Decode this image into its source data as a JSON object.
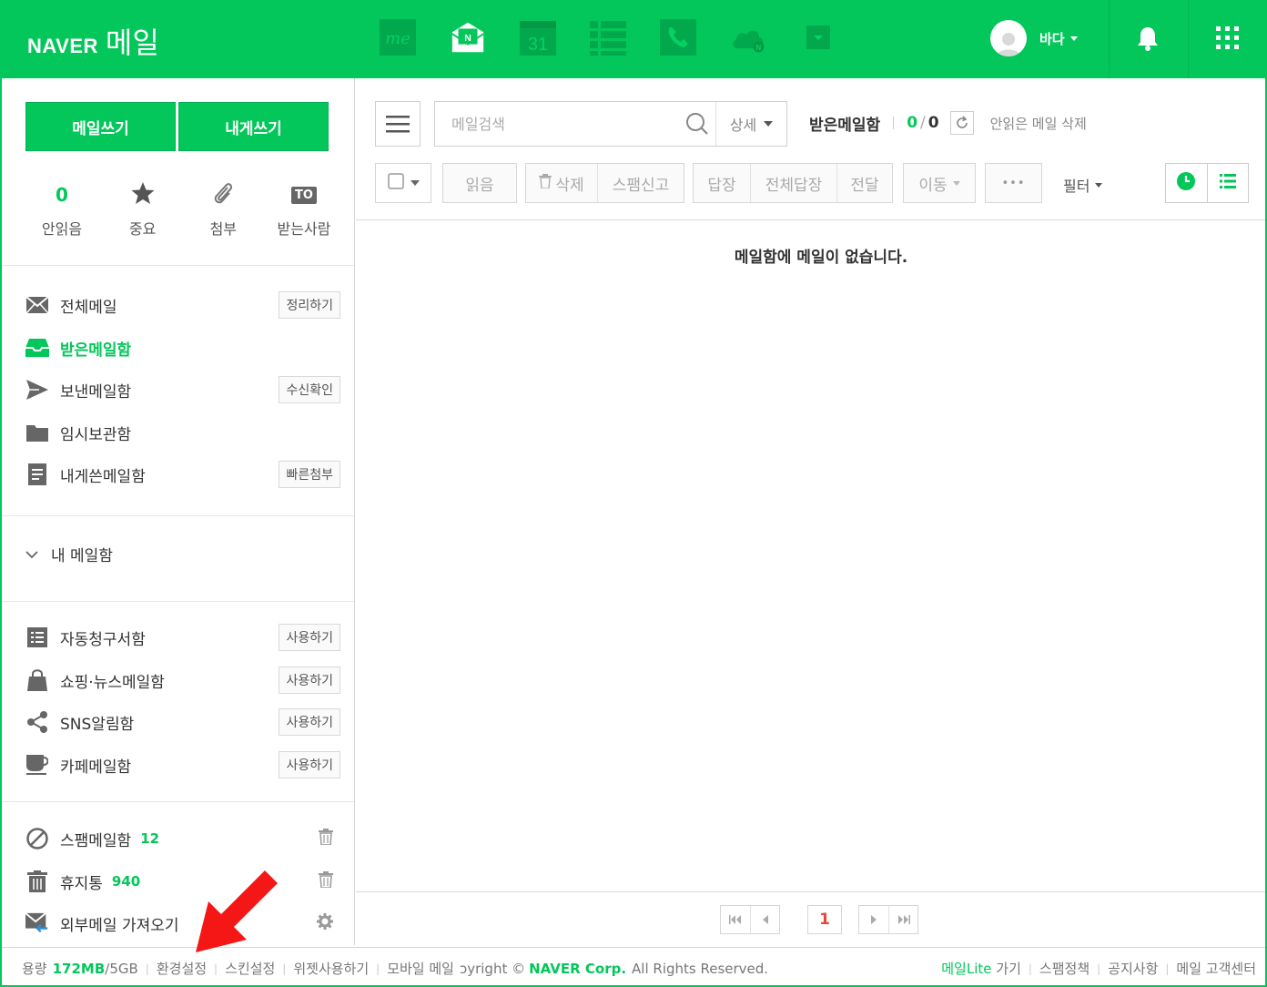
{
  "header": {
    "logo_naver": "NAVER",
    "logo_mail": "메일",
    "apps": [
      "me-icon",
      "mail-icon",
      "calendar-icon",
      "contacts-icon",
      "phone-icon",
      "cloud-icon",
      "more-dropdown-icon"
    ],
    "calendar_day": "31",
    "profile_name": "바다",
    "brand_color": "#03c75a"
  },
  "sidebar": {
    "write_mail": "메일쓰기",
    "write_to_me": "내게쓰기",
    "quick": {
      "unread_count": "0",
      "unread_label": "안읽음",
      "important_label": "중요",
      "attach_label": "첨부",
      "to_badge": "TO",
      "recipient_label": "받는사람"
    },
    "folders": [
      {
        "label": "전체메일",
        "button": "정리하기",
        "icon": "envelope-icon"
      },
      {
        "label": "받은메일함",
        "button": "",
        "icon": "inbox-icon"
      },
      {
        "label": "보낸메일함",
        "button": "수신확인",
        "icon": "send-icon"
      },
      {
        "label": "임시보관함",
        "button": "",
        "icon": "folder-icon"
      },
      {
        "label": "내게쓴메일함",
        "button": "빠른첨부",
        "icon": "note-icon"
      }
    ],
    "my_mailbox": "내 메일함",
    "smart_folders": [
      {
        "label": "자동청구서함",
        "button": "사용하기",
        "icon": "receipt-icon"
      },
      {
        "label": "쇼핑·뉴스메일함",
        "button": "사용하기",
        "icon": "shopping-bag-icon"
      },
      {
        "label": "SNS알림함",
        "button": "사용하기",
        "icon": "share-icon"
      },
      {
        "label": "카페메일함",
        "button": "사용하기",
        "icon": "coffee-cup-icon"
      }
    ],
    "spam": {
      "label": "스팸메일함",
      "count": "12"
    },
    "trash": {
      "label": "휴지통",
      "count": "940"
    },
    "external": {
      "label": "외부메일 가져오기"
    }
  },
  "main": {
    "search": {
      "placeholder": "메일검색",
      "detail": "상세"
    },
    "mailbox_title": "받은메일함",
    "unread": "0",
    "count_sep": "/",
    "total": "0",
    "delete_unread": "안읽은 메일 삭제",
    "toolbar": {
      "read": "읽음",
      "delete": "삭제",
      "spam": "스팸신고",
      "reply": "답장",
      "reply_all": "전체답장",
      "forward": "전달",
      "move": "이동",
      "more": "•••",
      "filter": "필터"
    },
    "empty_message": "메일함에 메일이 없습니다.",
    "page": "1"
  },
  "footer": {
    "quota_label": "용량",
    "quota_used": "172MB",
    "quota_max": "/5GB",
    "settings": "환경설정",
    "skin": "스킨설정",
    "widget": "위젯사용하기",
    "mobile": "모바일 메일",
    "copyright": "ɔyright ©",
    "corp": "NAVER Corp.",
    "rights": "All Rights Reserved.",
    "lite_green": "메일Lite",
    "lite_rest": " 가기",
    "spam_policy": "스팸정책",
    "notice": "공지사항",
    "support": "메일 고객센터"
  }
}
